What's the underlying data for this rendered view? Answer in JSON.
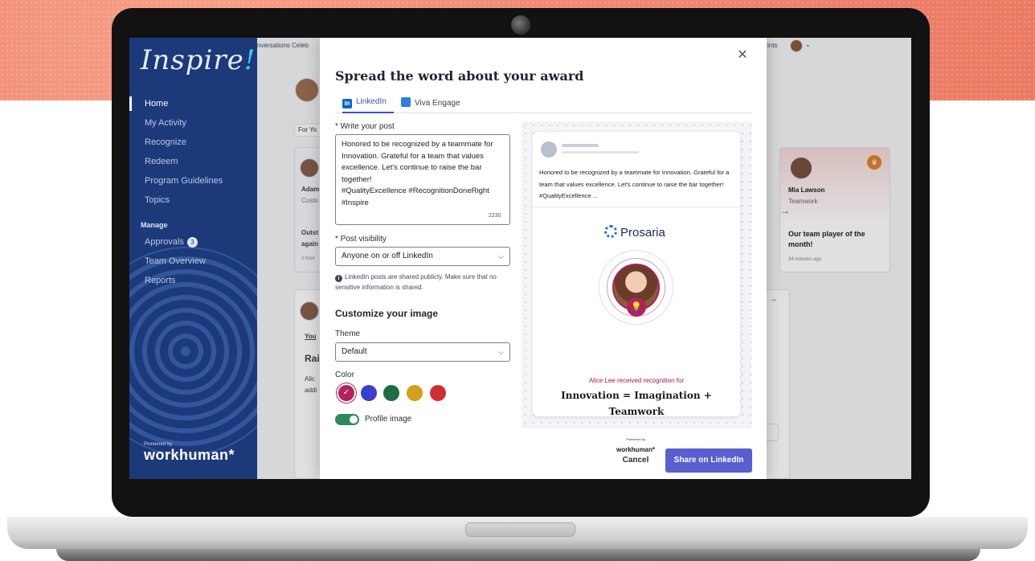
{
  "sidebar": {
    "logo": "Inspire",
    "logo_bang": "!",
    "items": [
      {
        "label": "Home"
      },
      {
        "label": "My Activity"
      },
      {
        "label": "Recognize"
      },
      {
        "label": "Redeem"
      },
      {
        "label": "Program Guidelines"
      },
      {
        "label": "Topics"
      }
    ],
    "manage_heading": "Manage",
    "manage_items": [
      {
        "label": "Approvals",
        "badge": "3"
      },
      {
        "label": "Team Overview"
      },
      {
        "label": "Reports"
      }
    ],
    "footer_pioneered": "Pioneered by",
    "footer_brand": "workhuman*"
  },
  "background": {
    "topbar_left": "nversations  Celeb",
    "topbar_right": "ints",
    "filter_label": "For Yo",
    "card_name": "Adam",
    "card_sub": "Custo",
    "card_title": "Outst",
    "card_title2": "again",
    "card_time": "2 hour",
    "right_card_name": "Mia Lawson",
    "right_card_sub": "Teamwork",
    "right_card_title": "Our team player of the month!",
    "right_card_time": "34 minutes ago",
    "feed_you": "You",
    "feed_title": "Rai",
    "feed_body1": "Alic",
    "feed_body2": "addi"
  },
  "modal": {
    "title": "Spread the word about your award",
    "close_icon": "close-icon",
    "tabs": [
      {
        "label": "LinkedIn",
        "icon": "linkedin-icon",
        "color": "#0a66c2"
      },
      {
        "label": "Viva Engage",
        "icon": "viva-engage-icon",
        "color": "#2f7de1"
      }
    ],
    "post_label": "* Write your post",
    "post_text": "Honored to be recognized by a teammate for Innovation. Grateful for a team that values excellence. Let's continue to raise the bar together!\n#QualityExcellence #RecognitionDoneRight #Inspire",
    "char_count": "2230",
    "visibility_label": "* Post visibility",
    "visibility_value": "Anyone on or off LinkedIn",
    "info_text": "LinkedIn posts are shared publicly. Make sure that no sensitive information is shared.",
    "customize_title": "Customize your image",
    "theme_label": "Theme",
    "theme_value": "Default",
    "color_label": "Color",
    "colors": [
      "#b3225a",
      "#3b3fd1",
      "#1e6b45",
      "#d4a017",
      "#cf2f33"
    ],
    "selected_color": "#b3225a",
    "profile_image_label": "Profile image",
    "profile_image_on": true,
    "cancel_label": "Cancel",
    "share_label": "Share on LinkedIn"
  },
  "preview": {
    "post_text": "Honored to be recognized by a teammate for Innovation. Grateful for a team that values excellence. Let's continue to raise the bar together! #QualityExcellence ...",
    "company": "Prosaria",
    "recognition_line": "Alice Lee received recognition for",
    "award_name": "Innovation = Imagination + Teamwork",
    "powered_by": "Pioneered by",
    "powered_brand": "workhuman*"
  }
}
